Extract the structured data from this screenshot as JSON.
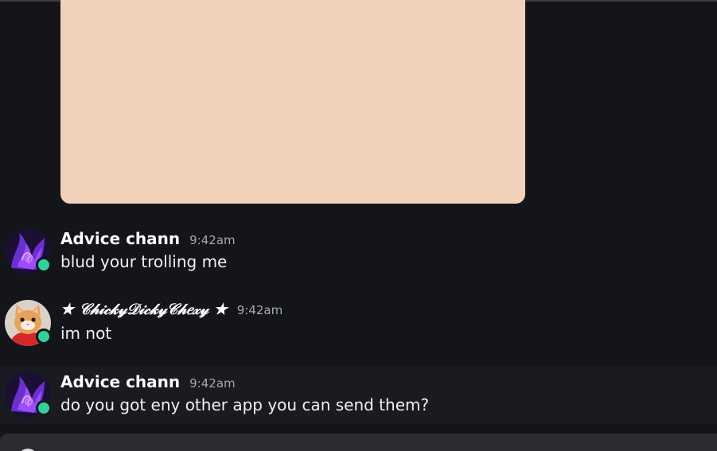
{
  "colors": {
    "background": "#141519",
    "highlight_row": "#191b20",
    "attachment": "#f2d1bb",
    "online": "#2fd39a",
    "composer": "#2b2d33"
  },
  "attachment": {
    "icon": "image-attachment"
  },
  "messages": [
    {
      "username": "Advice chann",
      "timestamp": "9:42am",
      "text": "blud your trolling me",
      "avatar": "purple-flame-avatar",
      "status": "online"
    },
    {
      "username": "★ 𝒞𝒽𝒾𝒸𝓀𝓎𝒟𝒾𝒸𝓀𝓎𝒞𝒽𝑒𝓍𝓎 ★",
      "timestamp": "9:42am",
      "text": "im not",
      "avatar": "cat-avatar",
      "status": "online"
    },
    {
      "username": "Advice chann",
      "timestamp": "9:42am",
      "text": "do you got eny other app you can send them?",
      "avatar": "purple-flame-avatar",
      "status": "online"
    }
  ],
  "composer": {
    "icon": "add-circle-icon"
  }
}
